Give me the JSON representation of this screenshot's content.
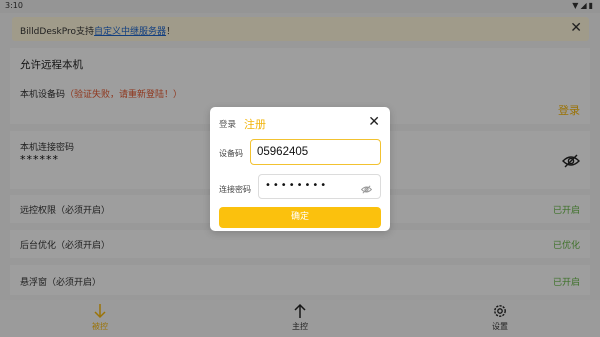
{
  "statusbar": {
    "time": "3:10"
  },
  "banner": {
    "prefix": "BilldDeskPro支持",
    "link": "自定义中继服务器",
    "suffix": "！"
  },
  "main": {
    "allow_remote_title": "允许远程本机",
    "device_code_label": "本机设备码",
    "device_code_warning": "（验证失败，请重新登陆！）",
    "login_link": "登录",
    "password_label": "本机连接密码",
    "password_masked": "******"
  },
  "permissions": [
    {
      "label": "远控权限（必须开启）",
      "status": "已开启"
    },
    {
      "label": "后台优化（必须开启）",
      "status": "已优化"
    },
    {
      "label": "悬浮窗（必须开启）",
      "status": "已开启"
    }
  ],
  "bottom_nav": {
    "items": [
      {
        "label": "被控",
        "icon": "arrow-down-icon",
        "active": true
      },
      {
        "label": "主控",
        "icon": "arrow-up-icon",
        "active": false
      },
      {
        "label": "设置",
        "icon": "gear-icon",
        "active": false
      }
    ]
  },
  "dialog": {
    "tab_login": "登录",
    "tab_register": "注册",
    "device_code_label": "设备码",
    "device_code_value": "05962405",
    "password_label": "连接密码",
    "password_value": "••••••••",
    "confirm_label": "确定"
  },
  "colors": {
    "accent": "#f2b40a",
    "enabled_green": "#62b140",
    "warning_red": "#e0552d",
    "link_blue": "#1d63c8"
  }
}
